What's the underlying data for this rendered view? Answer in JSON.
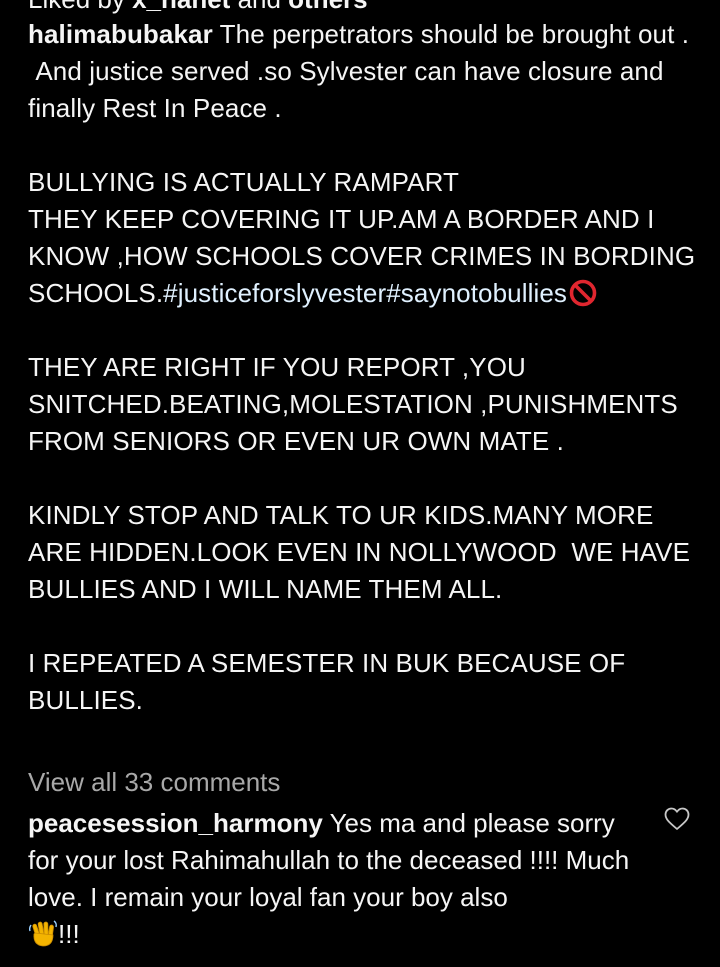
{
  "post": {
    "liked_by_prefix": "Liked by ",
    "liked_by_user": "x_nanet",
    "liked_by_and": " and ",
    "liked_by_others": "others",
    "author": "halimabubakar",
    "caption_lines": [
      "The perpetrators should be brought out .",
      " And justice served .so Sylvester can have closure and finally Rest In Peace .",
      "BULLYING IS ACTUALLY RAMPART",
      "THEY KEEP COVERING IT UP.AM A BORDER AND I KNOW ,HOW SCHOOLS COVER CRIMES IN BORDING SCHOOLS.",
      "THEY ARE RIGHT IF YOU REPORT ,YOU SNITCHED.BEATING,MOLESTATION ,PUNISHMENTS FROM SENIORS OR EVEN UR OWN MATE .",
      "KINDLY STOP AND TALK TO UR KIDS.MANY MORE ARE HIDDEN.LOOK EVEN IN NOLLYWOOD  WE HAVE BULLIES AND I WILL NAME THEM ALL.",
      "I REPEATED A SEMESTER IN BUK BECAUSE OF BULLIES."
    ],
    "hashtags": [
      "#justiceforslyvester",
      "#saynotobullies"
    ],
    "hashtag_emoji": "no-entry-icon"
  },
  "comments": {
    "view_all_label": "View all 33 comments",
    "items": [
      {
        "username": "peacesession_harmony",
        "text_line1": "Yes ma and please sorry for your lost Rahimahullah to the deceased !!!! Much love. I remain your loyal fan your boy also",
        "trailing_emoji": "waving-hand-icon",
        "trailing_text": "!!!"
      }
    ]
  },
  "icons": {
    "like": "heart-outline-icon"
  },
  "colors": {
    "background": "#000000",
    "text": "#f5f5f5",
    "muted": "#a8a8a8",
    "hashtag": "#e0f1ff",
    "no_entry_red": "#e0262f"
  }
}
